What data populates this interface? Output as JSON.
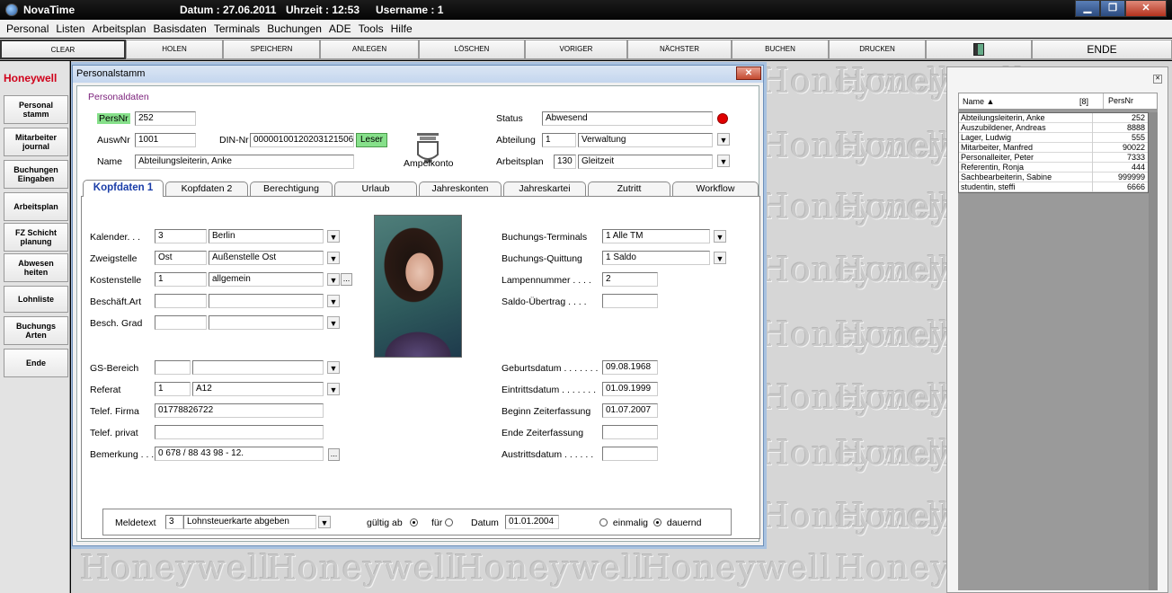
{
  "titlebar": {
    "app": "NovaTime",
    "datum": "Datum : 27.06.2011",
    "uhrzeit": "Uhrzeit : 12:53",
    "username": "Username : 1"
  },
  "menu": [
    "Personal",
    "Listen",
    "Arbeitsplan",
    "Basisdaten",
    "Terminals",
    "Buchungen",
    "ADE",
    "Tools",
    "Hilfe"
  ],
  "toolbar": {
    "clear": "Clear",
    "holen": "Holen",
    "speichern": "Speichern",
    "anlegen": "Anlegen",
    "loeschen": "Löschen",
    "voriger": "Voriger",
    "naechster": "Nächster",
    "buchen": "Buchen",
    "drucken": "Drucken",
    "ende": "ENDE"
  },
  "sidebar": {
    "logo": "Honeywell",
    "items": [
      "Personal\nstamm",
      "Mitarbeiter\njournal",
      "Buchungen\nEingaben",
      "Arbeitsplan",
      "FZ Schicht\nplanung",
      "Abwesen\nheiten",
      "Lohnliste",
      "Buchungs\nArten",
      "Ende"
    ]
  },
  "watermark": "Honeywell",
  "dialog": {
    "title": "Personalstamm",
    "section": "Personaldaten",
    "persnr_label": "PersNr",
    "persnr": "252",
    "auswnr_label": "AuswNr",
    "auswnr": "1001",
    "dinnr_label": "DIN-Nr",
    "dinnr": "00000100120203121506",
    "leser": "Leser",
    "name_label": "Name",
    "name": "Abteilungsleiterin, Anke",
    "ampelkonto": "Ampelkonto",
    "status_label": "Status",
    "status": "Abwesend",
    "abteilung_label": "Abteilung",
    "abteilung_nr": "1",
    "abteilung": "Verwaltung",
    "arbeitsplan_label": "Arbeitsplan",
    "arbeitsplan_nr": "130",
    "arbeitsplan": "Gleitzeit",
    "status_color": "#e00000"
  },
  "tabs": [
    "Kopfdaten 1",
    "Kopfdaten 2",
    "Berechtigung",
    "Urlaub",
    "Jahreskonten",
    "Jahreskartei",
    "Zutritt",
    "Workflow"
  ],
  "kopf": {
    "kalender_label": "Kalender. . .",
    "kalender_nr": "3",
    "kalender": "Berlin",
    "zweig_label": "Zweigstelle",
    "zweig_nr": "Ost",
    "zweig": "Außenstelle Ost",
    "kosten_label": "Kostenstelle",
    "kosten_nr": "1",
    "kosten": "allgemein",
    "beschart_label": "Beschäft.Art",
    "beschgrad_label": "Besch. Grad",
    "gs_label": "GS-Bereich",
    "referat_label": "Referat",
    "referat_nr": "1",
    "referat": "A12",
    "tfirma_label": "Telef. Firma",
    "tfirma": "01778826722",
    "tprivat_label": "Telef. privat",
    "bemerkung_label": "Bemerkung . . .",
    "bemerkung": "0 678 / 88 43 98 - 12.",
    "bterm_label": "Buchungs-Terminals",
    "bterm": "1 Alle TM",
    "bquitt_label": "Buchungs-Quittung",
    "bquitt": "1 Saldo",
    "lampe_label": "Lampennummer . . . .",
    "lampe": "2",
    "saldo_label": "Saldo-Übertrag . . . .",
    "geb_label": "Geburtsdatum . . . . . . .",
    "geb": "09.08.1968",
    "eintritt_label": "Eintrittsdatum . . . . . . .",
    "eintritt": "01.09.1999",
    "beginn_label": "Beginn Zeiterfassung",
    "beginn": "01.07.2007",
    "ende_label": "Ende  Zeiterfassung",
    "austritt_label": "Austrittsdatum . . . . . ."
  },
  "meld": {
    "label": "Meldetext",
    "nr": "3",
    "text": "Lohnsteuerkarte abgeben",
    "gueltig": "gültig ab",
    "fuer": "für",
    "datum_label": "Datum",
    "datum": "01.01.2004",
    "einmalig": "einmalig",
    "dauernd": "dauernd"
  },
  "list": {
    "col_name": "Name ▲",
    "count": "[8]",
    "col_persnr": "PersNr",
    "rows": [
      {
        "name": "Abteilungsleiterin, Anke",
        "nr": "252"
      },
      {
        "name": "Auszubildener, Andreas",
        "nr": "8888"
      },
      {
        "name": "Lager, Ludwig",
        "nr": "555"
      },
      {
        "name": "Mitarbeiter, Manfred",
        "nr": "90022"
      },
      {
        "name": "Personalleiter, Peter",
        "nr": "7333"
      },
      {
        "name": "Referentin, Ronja",
        "nr": "444"
      },
      {
        "name": "Sachbearbeiterin, Sabine",
        "nr": "999999"
      },
      {
        "name": "studentin, steffi",
        "nr": "6666"
      }
    ]
  }
}
